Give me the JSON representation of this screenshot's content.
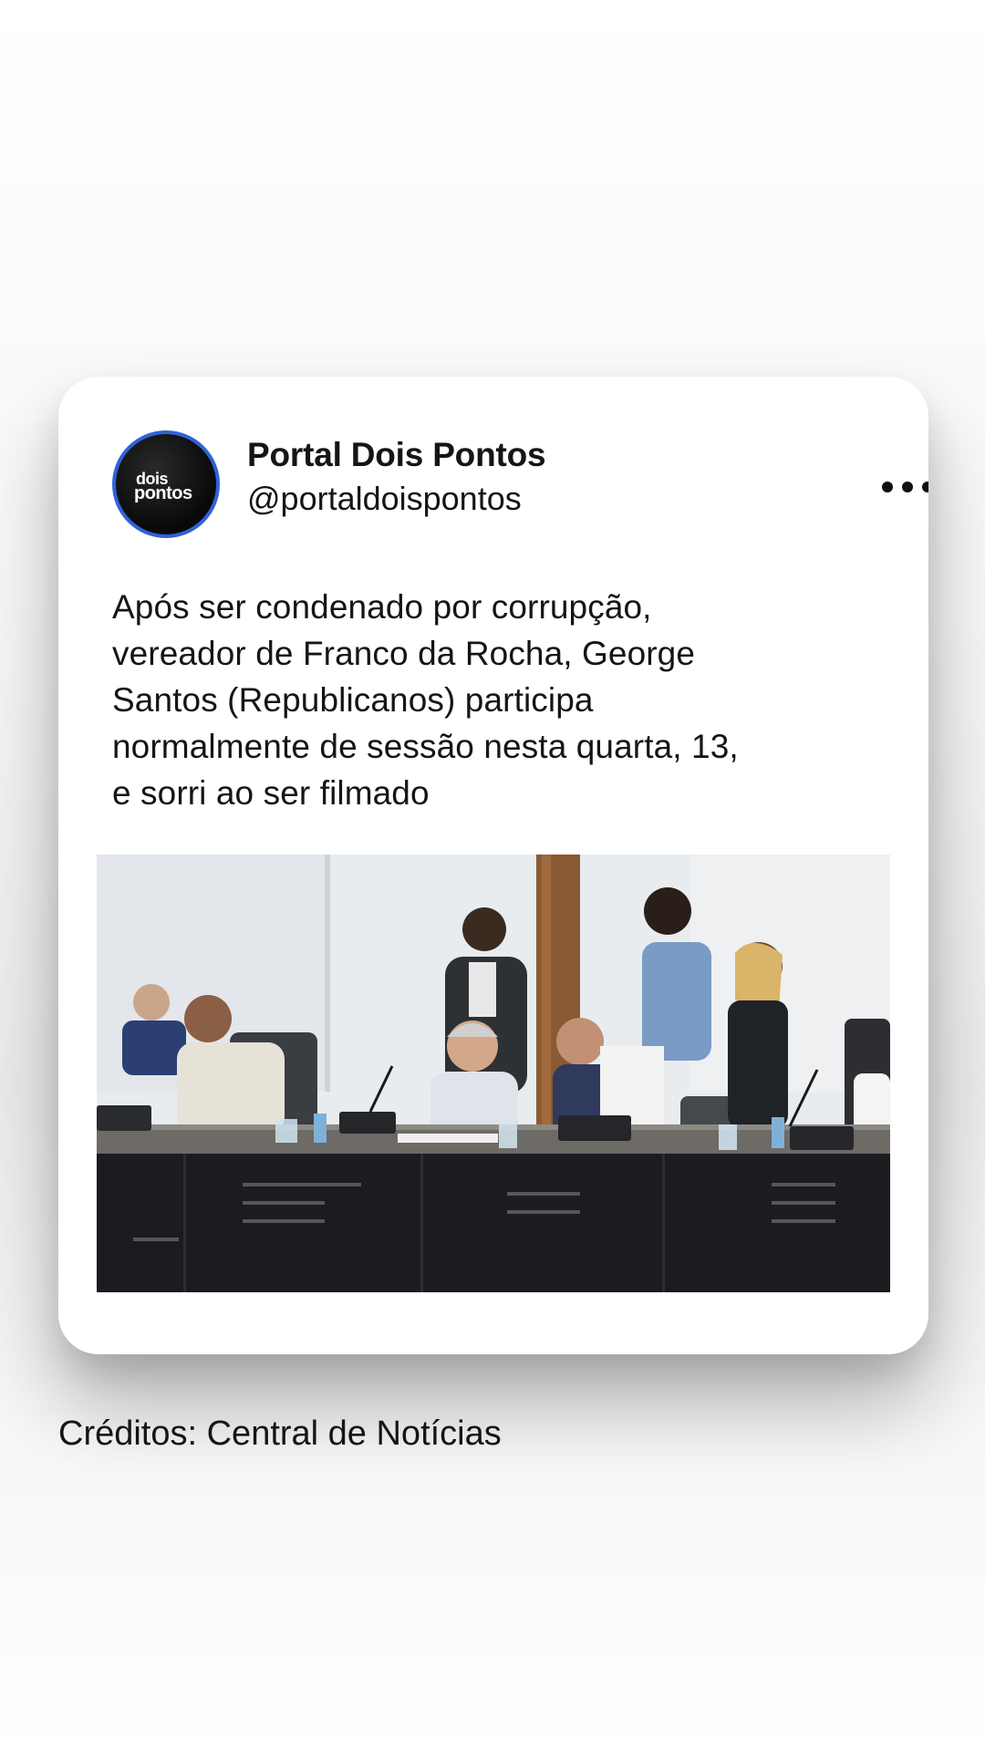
{
  "post": {
    "author_name": "Portal Dois Pontos",
    "author_handle": "@portaldoispontos",
    "avatar_logo": {
      "line1": "dois",
      "line2": "pontos"
    },
    "more_icon": "more-horizontal-icon",
    "text_lines": [
      "Após ser condenado por corrupção,",
      "vereador de Franco da Rocha, George",
      "Santos (Republicanos) participa",
      "normalmente de sessão nesta quarta, 13,",
      "e sorri ao ser filmado"
    ],
    "image": "council-session-photo"
  },
  "credits": "Créditos: Central de Notícias",
  "colors": {
    "avatar_ring": "#2f62d8",
    "text": "#151515",
    "card": "#ffffff"
  }
}
